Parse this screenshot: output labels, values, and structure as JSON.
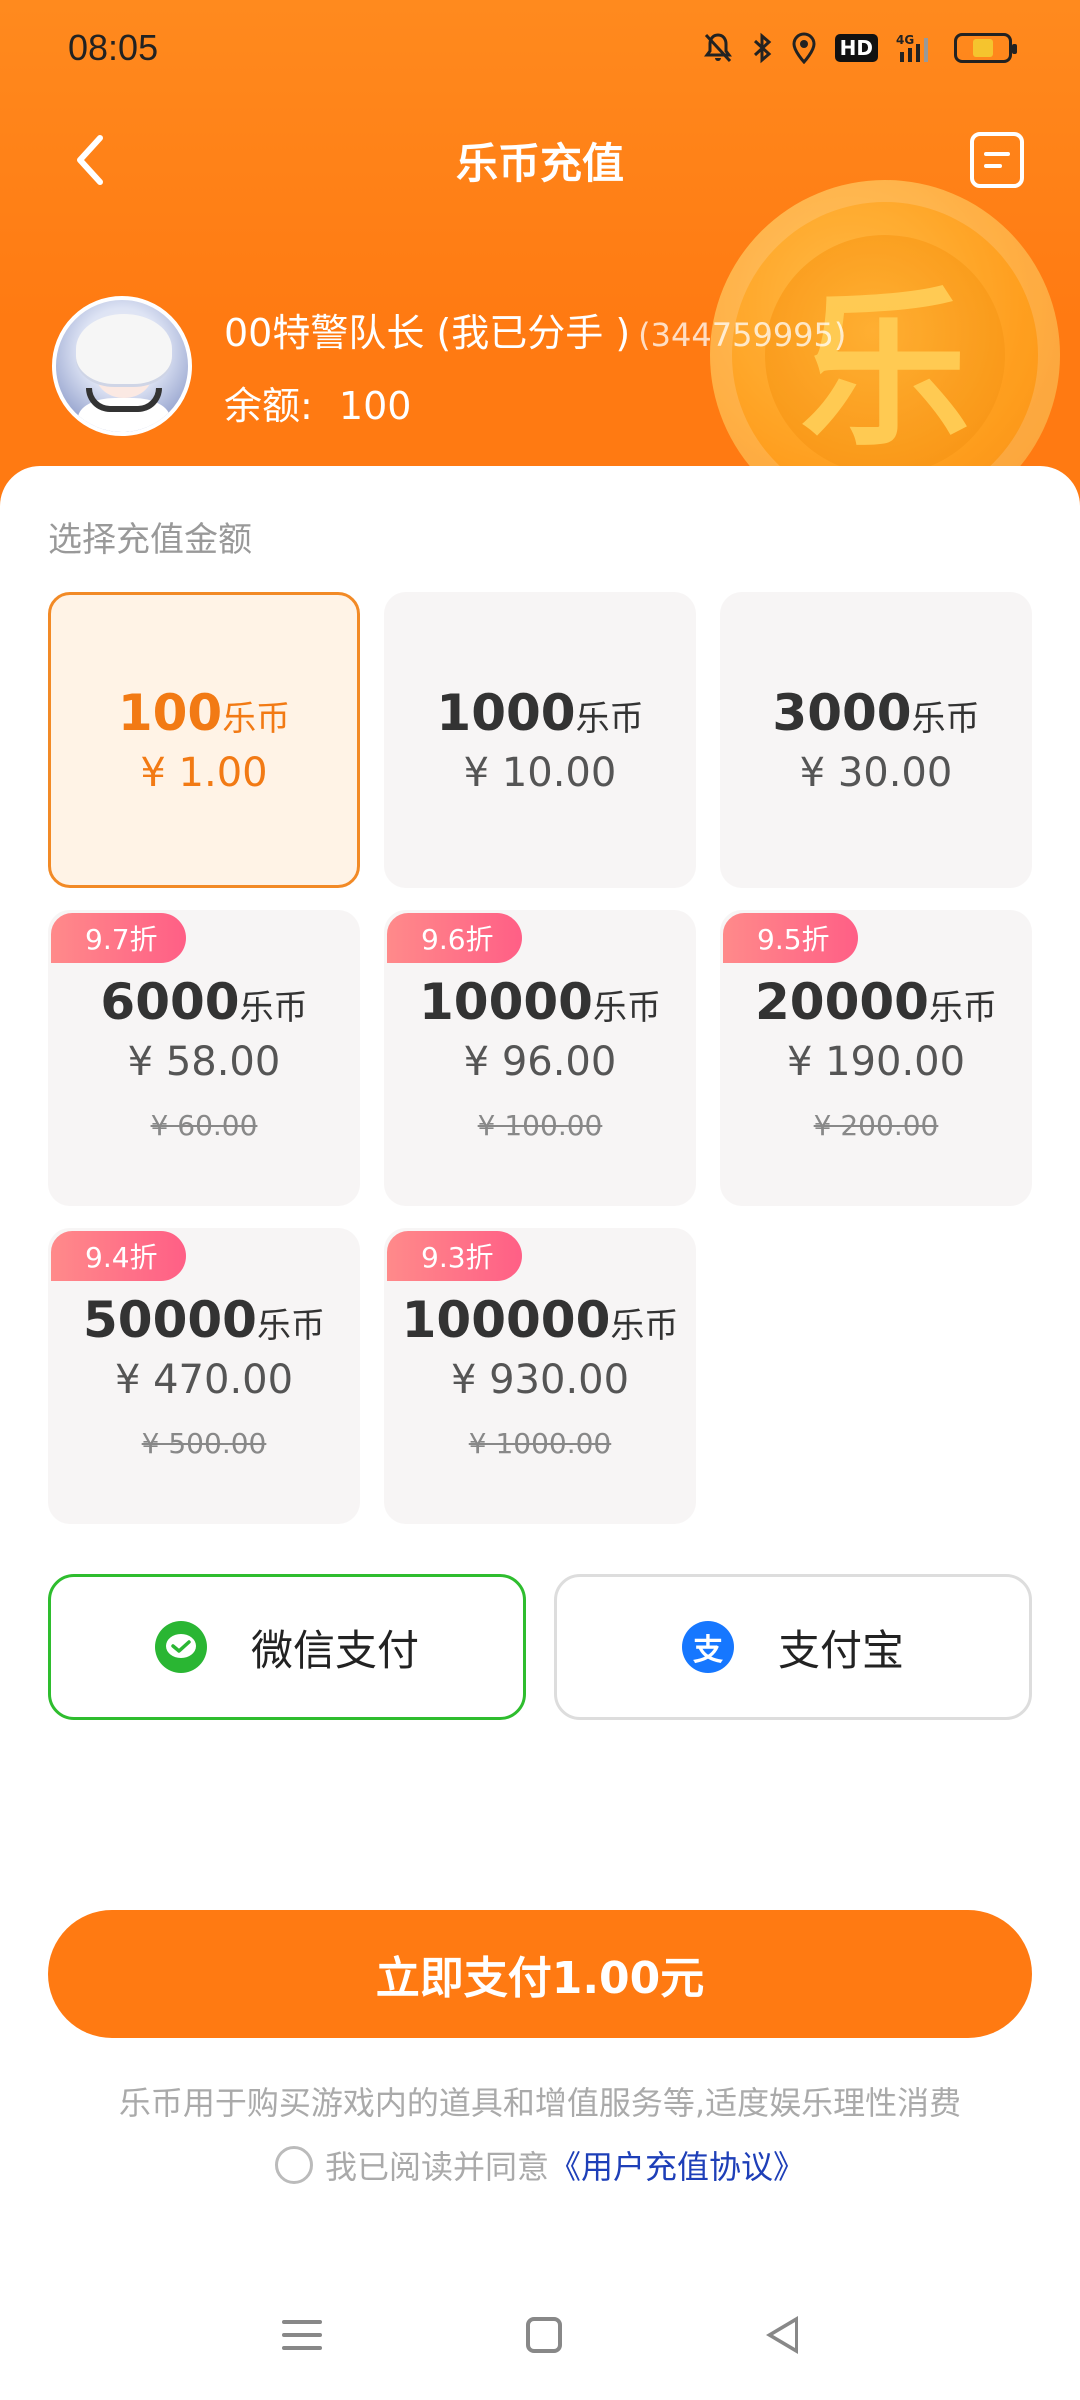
{
  "status": {
    "time": "08:05",
    "icons": [
      "mute-bell-icon",
      "bluetooth-icon",
      "location-icon",
      "hd-icon",
      "signal-4g-icon",
      "battery-icon"
    ],
    "hd": "HD",
    "network": "4G"
  },
  "nav": {
    "title": "乐币充值"
  },
  "user": {
    "name": "00特警队长 (我已分手 )",
    "id": "(344759995)",
    "balance_label": "余额:",
    "balance_value": "100"
  },
  "coin_glyph": "乐",
  "section_label": "选择充值金额",
  "packages": [
    {
      "coins": "100",
      "unit": "乐币",
      "price": "¥ 1.00",
      "selected": true
    },
    {
      "coins": "1000",
      "unit": "乐币",
      "price": "¥ 10.00"
    },
    {
      "coins": "3000",
      "unit": "乐币",
      "price": "¥ 30.00"
    },
    {
      "coins": "6000",
      "unit": "乐币",
      "price": "¥ 58.00",
      "discount": "9.7折",
      "original": "¥ 60.00"
    },
    {
      "coins": "10000",
      "unit": "乐币",
      "price": "¥ 96.00",
      "discount": "9.6折",
      "original": "¥ 100.00"
    },
    {
      "coins": "20000",
      "unit": "乐币",
      "price": "¥ 190.00",
      "discount": "9.5折",
      "original": "¥ 200.00"
    },
    {
      "coins": "50000",
      "unit": "乐币",
      "price": "¥ 470.00",
      "discount": "9.4折",
      "original": "¥ 500.00"
    },
    {
      "coins": "100000",
      "unit": "乐币",
      "price": "¥ 930.00",
      "discount": "9.3折",
      "original": "¥ 1000.00"
    }
  ],
  "payment": {
    "wechat_label": "微信支付",
    "alipay_label": "支付宝",
    "alipay_glyph": "支",
    "selected": "wechat"
  },
  "pay_now_label": "立即支付1.00元",
  "notice": "乐币用于购买游戏内的道具和增值服务等,适度娱乐理性消费",
  "agreement": {
    "prefix": "我已阅读并同意",
    "link": "《用户充值协议》"
  },
  "colors": {
    "accent": "#ff7a12",
    "selected_border": "#f28a26",
    "wechat_green": "#2ab633",
    "alipay_blue": "#1677ff",
    "discount_badge": "#ff6b86"
  }
}
